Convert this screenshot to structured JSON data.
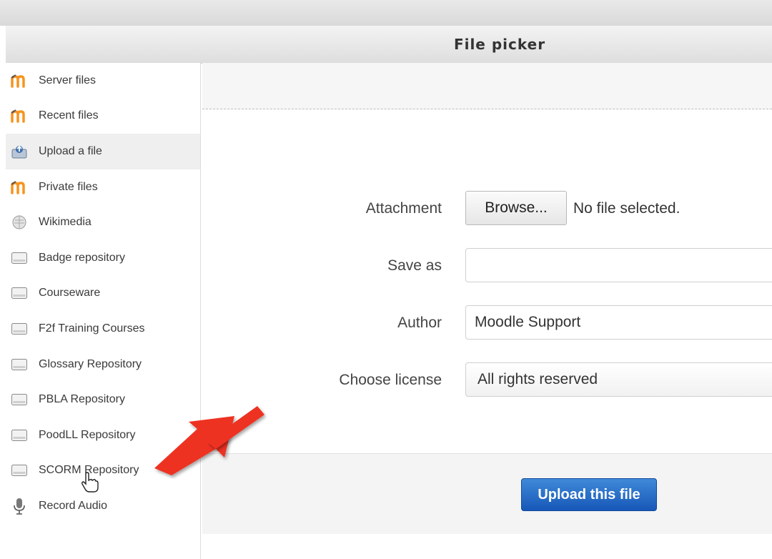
{
  "window": {
    "title": "File picker"
  },
  "sidebar": {
    "items": [
      {
        "label": "Server files",
        "icon": "moodle-icon"
      },
      {
        "label": "Recent files",
        "icon": "moodle-icon"
      },
      {
        "label": "Upload a file",
        "icon": "upload-icon"
      },
      {
        "label": "Private files",
        "icon": "moodle-icon"
      },
      {
        "label": "Wikimedia",
        "icon": "wikimedia-icon"
      },
      {
        "label": "Badge repository",
        "icon": "repository-icon"
      },
      {
        "label": "Courseware",
        "icon": "repository-icon"
      },
      {
        "label": "F2f Training Courses",
        "icon": "repository-icon"
      },
      {
        "label": "Glossary Repository",
        "icon": "repository-icon"
      },
      {
        "label": "PBLA Repository",
        "icon": "repository-icon"
      },
      {
        "label": "PoodLL Repository",
        "icon": "repository-icon"
      },
      {
        "label": "SCORM Repository",
        "icon": "repository-icon"
      },
      {
        "label": "Record Audio",
        "icon": "microphone-icon"
      }
    ],
    "active_item": "Upload a file"
  },
  "form": {
    "attachment": {
      "label": "Attachment",
      "button": "Browse...",
      "status": "No file selected."
    },
    "save_as": {
      "label": "Save as",
      "value": ""
    },
    "author": {
      "label": "Author",
      "value": "Moodle Support"
    },
    "license": {
      "label": "Choose license",
      "value": "All rights reserved"
    }
  },
  "footer": {
    "upload_button": "Upload this file"
  },
  "colors": {
    "accent": "#1f63c4",
    "arrow": "#ee3322",
    "moodle_orange": "#f7941d"
  }
}
